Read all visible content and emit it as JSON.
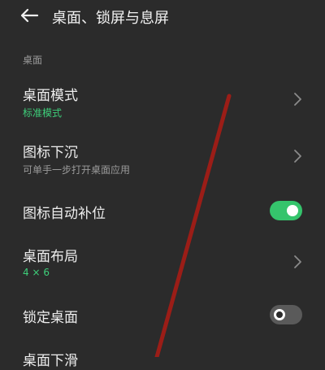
{
  "header": {
    "title": "桌面、锁屏与息屏",
    "back_icon": "arrow-left-icon"
  },
  "section": {
    "label": "桌面"
  },
  "rows": [
    {
      "title": "桌面模式",
      "subtitle": "标准模式",
      "control": "chevron"
    },
    {
      "title": "图标下沉",
      "subtitle": "可单手一步打开桌面应用",
      "control": "chevron"
    },
    {
      "title": "图标自动补位",
      "control": "toggle",
      "enabled": true
    },
    {
      "title": "桌面布局",
      "subtitle": "4 × 6",
      "control": "chevron"
    },
    {
      "title": "锁定桌面",
      "control": "toggle",
      "enabled": false
    },
    {
      "title": "桌面下滑"
    }
  ],
  "colors": {
    "background": "#2b2b2b",
    "accent_green": "#35c46c",
    "annotation_red": "#9b1d17"
  }
}
